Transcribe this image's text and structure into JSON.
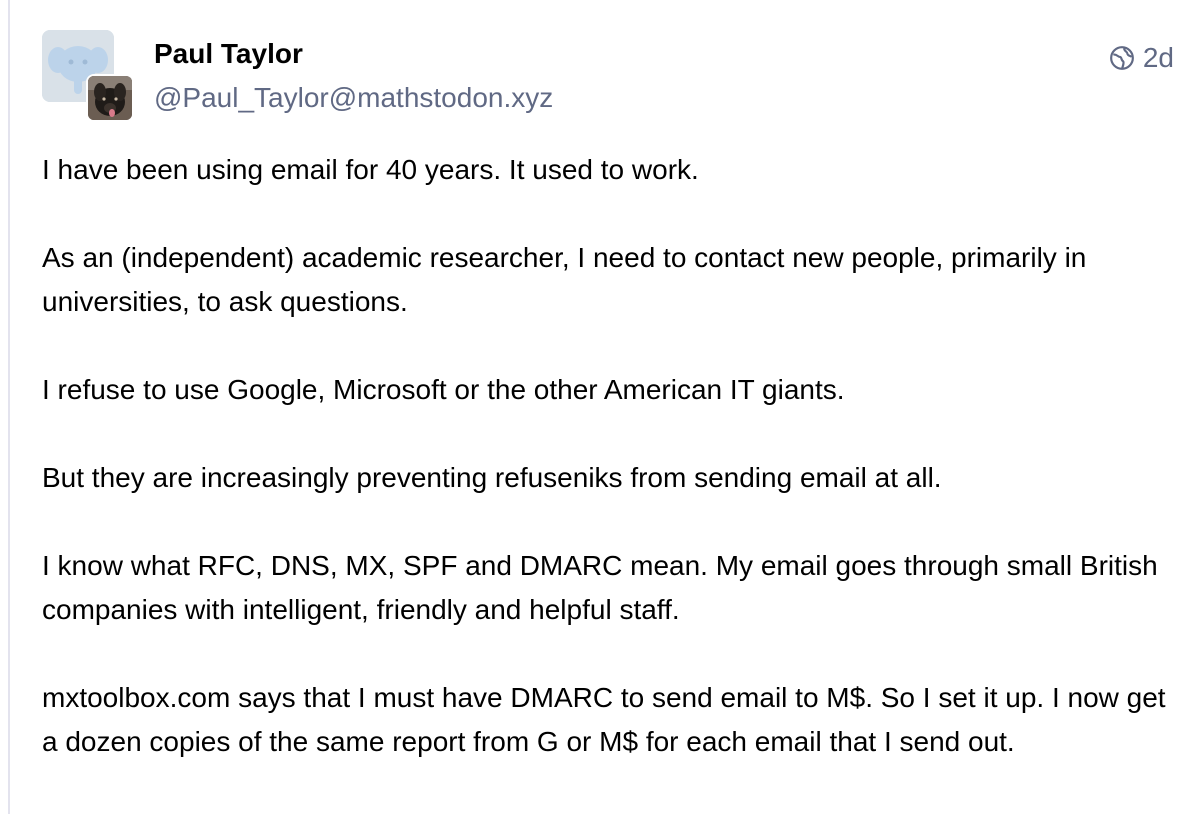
{
  "post": {
    "author": {
      "display_name": "Paul Taylor",
      "handle": "@Paul_Taylor@mathstodon.xyz",
      "avatar_icon": "mastodon-default-avatar-icon",
      "secondary_avatar_icon": "dog-photo-avatar"
    },
    "visibility_icon": "globe-icon",
    "timestamp": "2d",
    "paragraphs": [
      "I have been using email for 40 years. It used to work.",
      "As an (independent) academic researcher, I need to contact new people, primarily in universities, to ask questions.",
      "I refuse to use Google, Microsoft or the other American IT giants.",
      "But they are increasingly preventing refuseniks from sending email at all.",
      "I know what RFC, DNS, MX, SPF and DMARC mean.  My email goes through small British companies with intelligent, friendly and helpful staff.",
      "mxtoolbox.com says that I must have DMARC to send email to M$. So I set it up. I now get a dozen copies of the same report from G or M$ for each email that I send out."
    ]
  },
  "colors": {
    "text": "#000000",
    "muted": "#606984",
    "avatar_bg": "#d9e1e8",
    "rule": "#e3e3ee"
  }
}
